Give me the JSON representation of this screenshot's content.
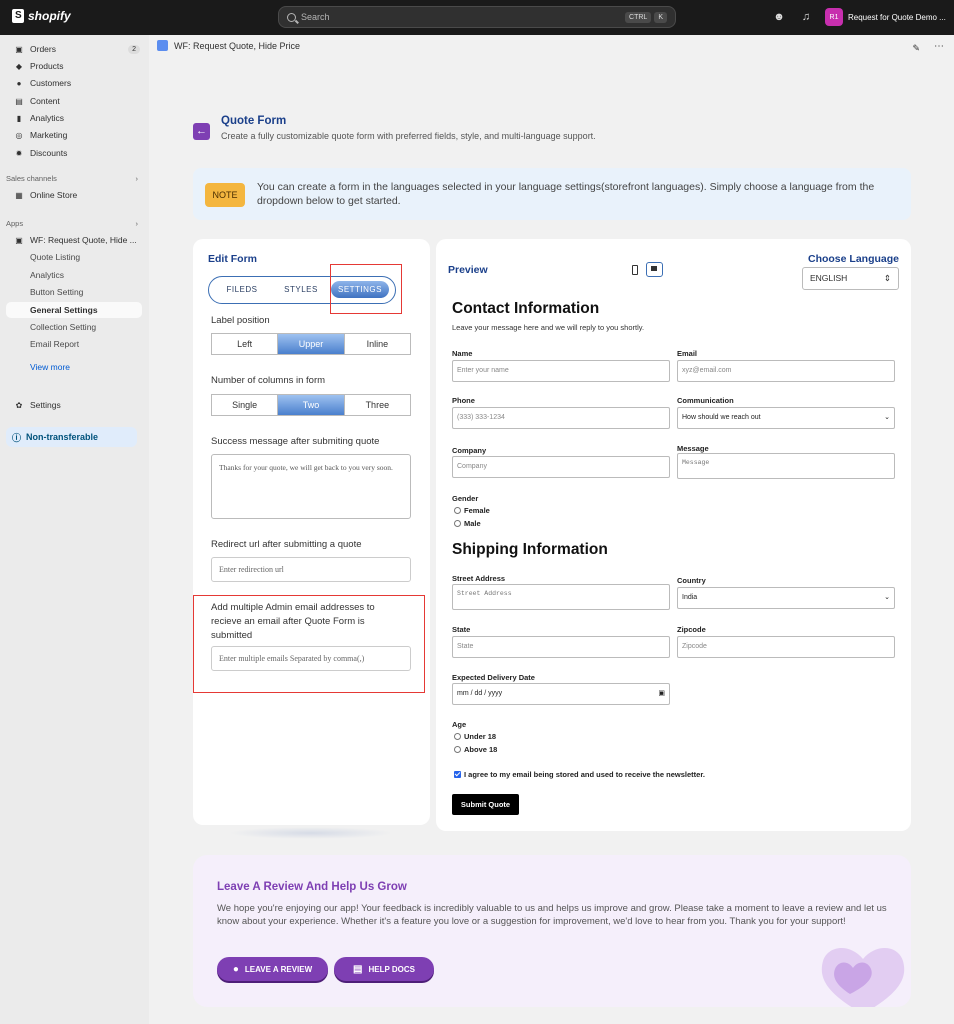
{
  "topbar": {
    "brand": "shopify",
    "search_placeholder": "Search",
    "kbd1": "CTRL",
    "kbd2": "K",
    "store_initials": "R1",
    "store_name": "Request for Quote Demo ..."
  },
  "sidebar": {
    "items": [
      {
        "label": "Orders",
        "count": "2"
      },
      {
        "label": "Products"
      },
      {
        "label": "Customers"
      },
      {
        "label": "Content"
      },
      {
        "label": "Analytics"
      },
      {
        "label": "Marketing"
      },
      {
        "label": "Discounts"
      }
    ],
    "sales_channels": "Sales channels",
    "online_store": "Online Store",
    "apps": "Apps",
    "app_name": "WF: Request Quote, Hide ...",
    "sub": [
      "Quote Listing",
      "Analytics",
      "Button Setting",
      "General Settings",
      "Collection Setting",
      "Email Report"
    ],
    "view_more": "View more",
    "settings": "Settings",
    "non_transferable": "Non-transferable"
  },
  "page": {
    "title": "WF: Request Quote, Hide Price"
  },
  "quote_form": {
    "title": "Quote Form",
    "subtitle": "Create a fully customizable quote form with preferred fields, style, and multi-language support."
  },
  "note": {
    "tag": "NOTE",
    "text": "You can create a form in the languages selected in your language settings(storefront languages). Simply choose a language from the dropdown below to get started."
  },
  "edit_form": {
    "title": "Edit Form",
    "tabs": [
      "FILEDS",
      "STYLES",
      "SETTINGS"
    ],
    "label_position": "Label position",
    "label_opts": [
      "Left",
      "Upper",
      "Inline"
    ],
    "columns": "Number of columns in form",
    "column_opts": [
      "Single",
      "Two",
      "Three"
    ],
    "success_label": "Success message after submiting quote",
    "success_text": "Thanks for your quote, we will get back to you very soon.",
    "redirect_label": "Redirect url after submitting a quote",
    "redirect_placeholder": "Enter redirection url",
    "emails_label": "Add multiple Admin email addresses to recieve an email after Quote Form is submitted",
    "emails_placeholder": "Enter multiple emails Separated by comma(,)"
  },
  "preview": {
    "title": "Preview",
    "choose_language": "Choose Language",
    "language": "ENGLISH",
    "contact_title": "Contact Information",
    "contact_sub": "Leave your message here and we will reply to you shortly.",
    "name": "Name",
    "name_ph": "Enter your name",
    "email": "Email",
    "email_ph": "xyz@email.com",
    "phone": "Phone",
    "phone_ph": "(333) 333-1234",
    "communication": "Communication",
    "communication_val": "How should we reach out",
    "company": "Company",
    "company_ph": "Company",
    "message": "Message",
    "message_ph": "Message",
    "gender": "Gender",
    "female": "Female",
    "male": "Male",
    "shipping_title": "Shipping Information",
    "street": "Street Address",
    "street_ph": "Street Address",
    "country": "Country",
    "country_val": "India",
    "state": "State",
    "state_ph": "State",
    "zipcode": "Zipcode",
    "zipcode_ph": "Zipcode",
    "delivery": "Expected Delivery Date",
    "delivery_ph": "mm / dd / yyyy",
    "age": "Age",
    "under18": "Under 18",
    "above18": "Above 18",
    "agree": "I agree to my email being stored and used to receive the newsletter.",
    "submit": "Submit Quote"
  },
  "review": {
    "title": "Leave A Review And Help Us Grow",
    "text": "We hope you're enjoying our app! Your feedback is incredibly valuable to us and helps us improve and grow. Please take a moment to leave a review and let us know about your experience. Whether it's a feature you love or a suggestion for improvement, we'd love to hear from you. Thank you for your support!",
    "btn1": "LEAVE A REVIEW",
    "btn2": "HELP DOCS"
  }
}
